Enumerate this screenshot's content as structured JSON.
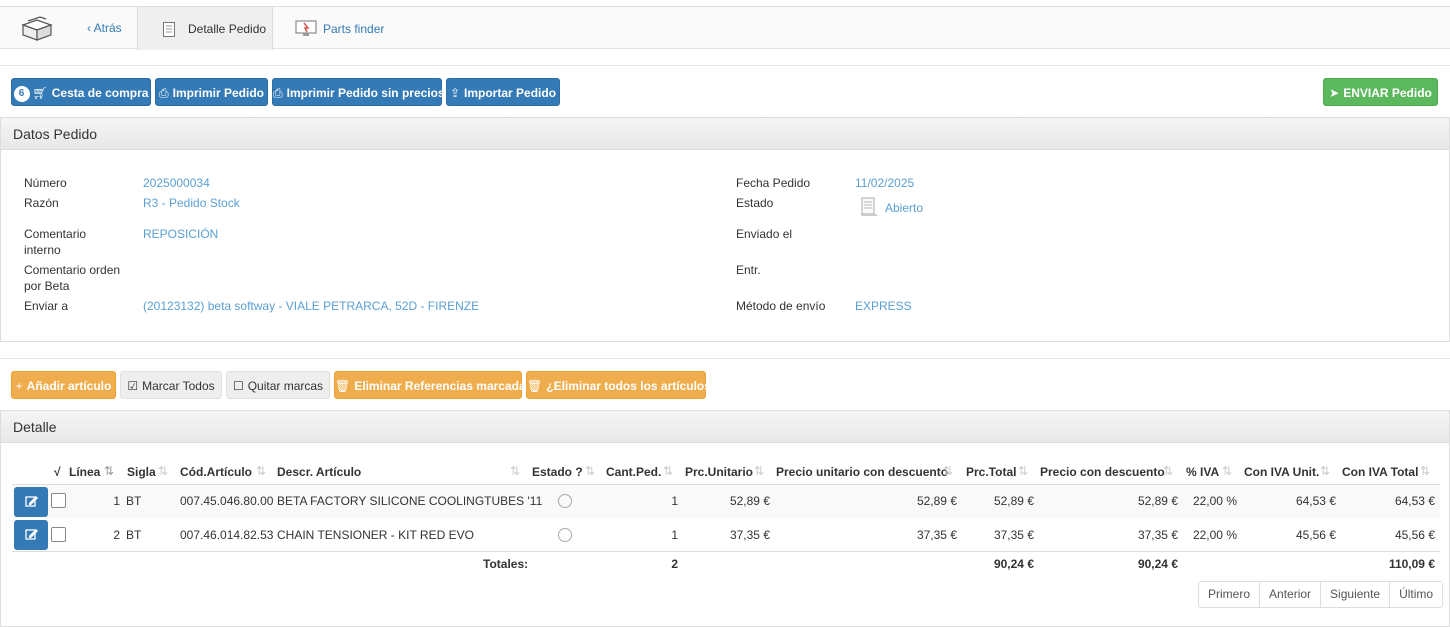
{
  "nav": {
    "back": "Atrás",
    "tab_detail": "Detalle Pedido",
    "tab_parts": "Parts finder"
  },
  "toolbar": {
    "cart_badge": "6",
    "cart": "Cesta de compra",
    "print": "Imprimir Pedido",
    "print_no_prices": "Imprimir Pedido sin precios",
    "import": "Importar Pedido",
    "send": "ENVIAR Pedido"
  },
  "datos": {
    "title": "Datos Pedido",
    "numero_label": "Número",
    "numero": "2025000034",
    "razon_label": "Razón",
    "razon": "R3 - Pedido Stock",
    "comentario_interno_label_1": "Comentario",
    "comentario_interno_label_2": "interno",
    "comentario_interno": "REPOSICIÓN",
    "comentario_orden_label_1": "Comentario orden",
    "comentario_orden_label_2": "por Beta",
    "enviar_label": "Enviar a",
    "enviar": "(20123132) beta softway - VIALE PETRARCA, 52D - FIRENZE",
    "fecha_label": "Fecha Pedido",
    "fecha": "11/02/2025",
    "estado_label": "Estado",
    "estado": "Abierto",
    "enviado_label": "Enviado el",
    "entr_label": "Entr.",
    "metodo_label": "Método de envío",
    "metodo": "EXPRESS"
  },
  "actions": {
    "add": "Añadir artículo",
    "mark_all": "Marcar Todos",
    "unmark": "Quitar marcas",
    "delete_marked": "Eliminar Referencias marcadas",
    "delete_all": "¿Eliminar todos los artículos?"
  },
  "detalle": {
    "title": "Detalle",
    "headers": {
      "check": "√",
      "linea": "Línea",
      "sigla": "Sigla",
      "cod": "Cód.Artículo",
      "descr": "Descr. Artículo",
      "estado": "Estado ?",
      "cant": "Cant.Ped.",
      "prc_unit": "Prc.Unitario",
      "prc_unit_desc": "Precio unitario con descuento",
      "prc_total": "Prc.Total",
      "precio_desc": "Precio con descuento",
      "iva": "% IVA",
      "iva_unit": "Con IVA Unit.",
      "iva_total": "Con IVA Total"
    },
    "rows": [
      {
        "linea": "1",
        "sigla": "BT",
        "cod": "007.45.046.80.00",
        "descr": "BETA FACTORY SILICONE COOLINGTUBES '11",
        "cant": "1",
        "prc_unit": "52,89 €",
        "prc_unit_desc": "52,89 €",
        "prc_total": "52,89 €",
        "precio_desc": "52,89 €",
        "iva": "22,00 %",
        "iva_unit": "64,53 €",
        "iva_total": "64,53 €"
      },
      {
        "linea": "2",
        "sigla": "BT",
        "cod": "007.46.014.82.53",
        "descr": "CHAIN TENSIONER - KIT RED EVO",
        "cant": "1",
        "prc_unit": "37,35 €",
        "prc_unit_desc": "37,35 €",
        "prc_total": "37,35 €",
        "precio_desc": "37,35 €",
        "iva": "22,00 %",
        "iva_unit": "45,56 €",
        "iva_total": "45,56 €"
      }
    ],
    "totals": {
      "label": "Totales:",
      "cant": "2",
      "prc_total": "90,24 €",
      "precio_desc": "90,24 €",
      "iva_total": "110,09 €"
    }
  },
  "pager": {
    "first": "Primero",
    "prev": "Anterior",
    "next": "Siguiente",
    "last": "Último"
  }
}
